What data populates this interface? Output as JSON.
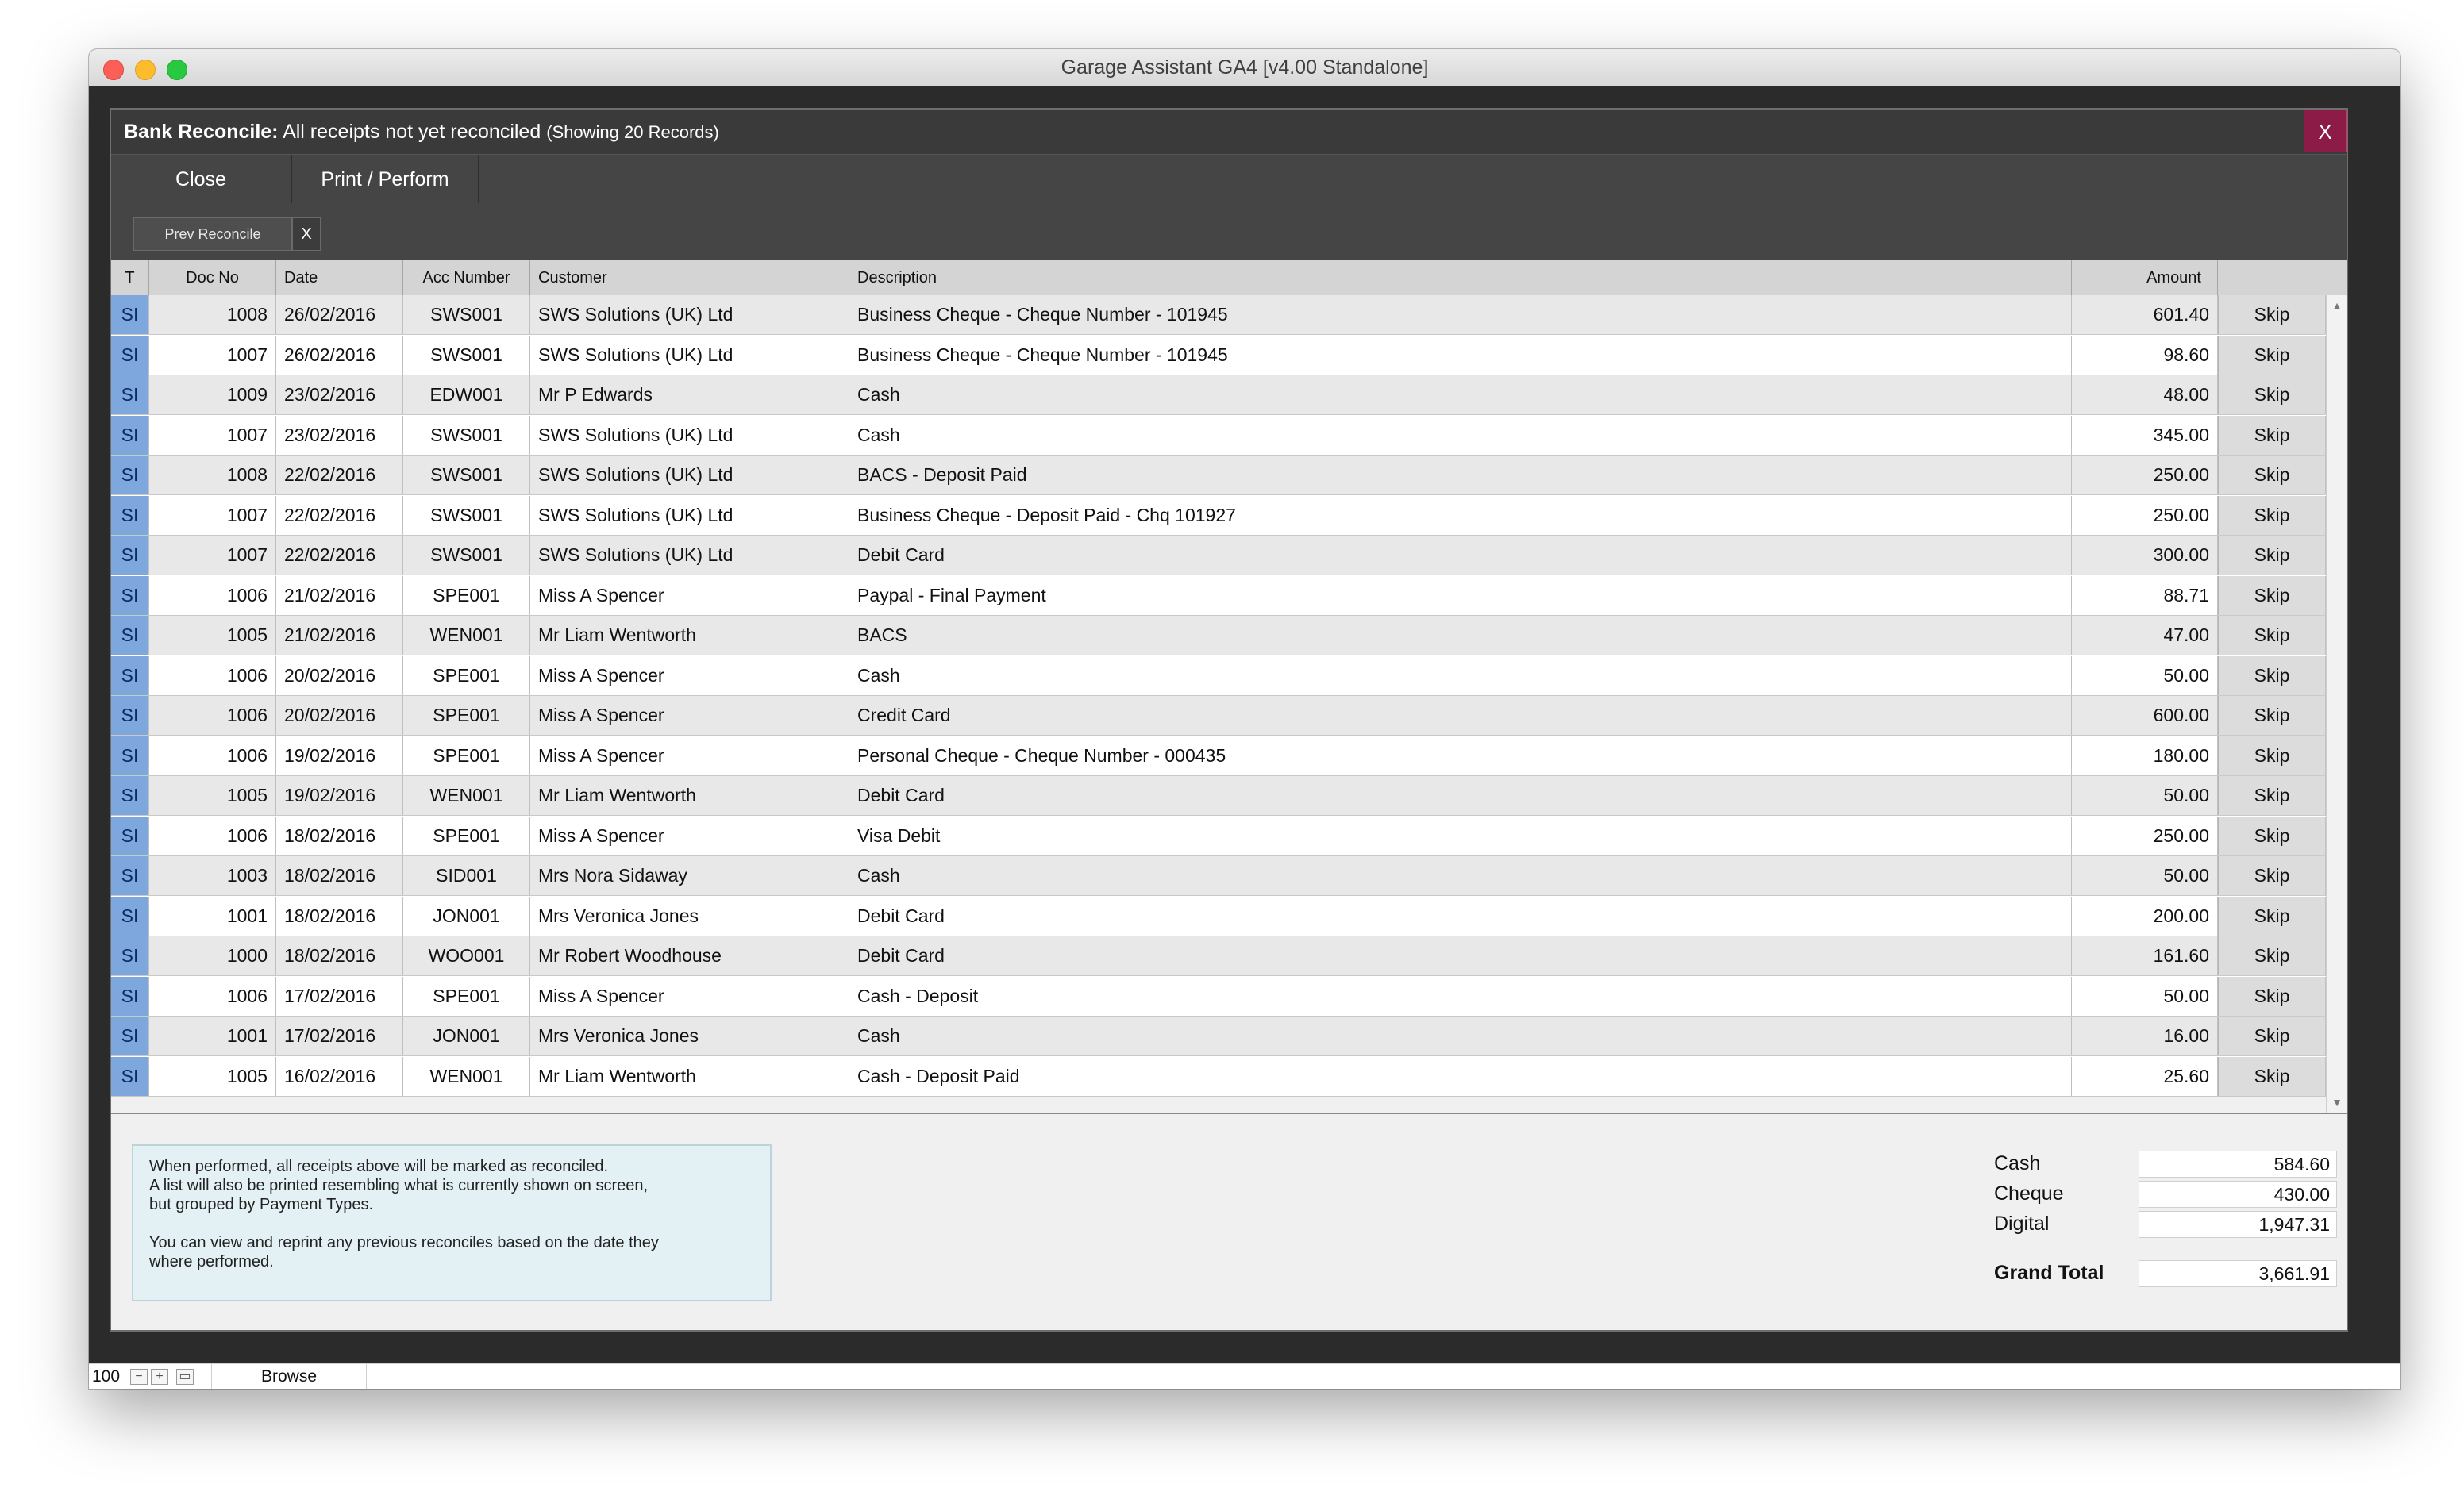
{
  "window": {
    "title": "Garage Assistant GA4 [v4.00 Standalone]"
  },
  "dialog": {
    "title_bold": "Bank Reconcile:",
    "title_rest": " All receipts not yet reconciled ",
    "title_count": "(Showing 20 Records)",
    "close_label": "X"
  },
  "toolbar": {
    "close_label": "Close",
    "print_label": "Print / Perform"
  },
  "filter": {
    "prev_label": "Prev Reconcile",
    "clear_label": "X"
  },
  "table": {
    "columns": {
      "t": "T",
      "doc": "Doc No",
      "date": "Date",
      "acc": "Acc Number",
      "customer": "Customer",
      "description": "Description",
      "amount": "Amount"
    },
    "rows": [
      {
        "t": "SI",
        "doc": "1008",
        "date": "26/02/2016",
        "acc": "SWS001",
        "customer": "SWS Solutions (UK) Ltd",
        "description": "Business Cheque - Cheque Number - 101945",
        "amount": "601.40",
        "action": "Skip"
      },
      {
        "t": "SI",
        "doc": "1007",
        "date": "26/02/2016",
        "acc": "SWS001",
        "customer": "SWS Solutions (UK) Ltd",
        "description": "Business Cheque - Cheque Number - 101945",
        "amount": "98.60",
        "action": "Skip"
      },
      {
        "t": "SI",
        "doc": "1009",
        "date": "23/02/2016",
        "acc": "EDW001",
        "customer": "Mr P Edwards",
        "description": "Cash",
        "amount": "48.00",
        "action": "Skip"
      },
      {
        "t": "SI",
        "doc": "1007",
        "date": "23/02/2016",
        "acc": "SWS001",
        "customer": "SWS Solutions (UK) Ltd",
        "description": "Cash",
        "amount": "345.00",
        "action": "Skip"
      },
      {
        "t": "SI",
        "doc": "1008",
        "date": "22/02/2016",
        "acc": "SWS001",
        "customer": "SWS Solutions (UK) Ltd",
        "description": "BACS - Deposit Paid",
        "amount": "250.00",
        "action": "Skip"
      },
      {
        "t": "SI",
        "doc": "1007",
        "date": "22/02/2016",
        "acc": "SWS001",
        "customer": "SWS Solutions (UK) Ltd",
        "description": "Business Cheque - Deposit Paid - Chq 101927",
        "amount": "250.00",
        "action": "Skip"
      },
      {
        "t": "SI",
        "doc": "1007",
        "date": "22/02/2016",
        "acc": "SWS001",
        "customer": "SWS Solutions (UK) Ltd",
        "description": "Debit Card",
        "amount": "300.00",
        "action": "Skip"
      },
      {
        "t": "SI",
        "doc": "1006",
        "date": "21/02/2016",
        "acc": "SPE001",
        "customer": "Miss A Spencer",
        "description": "Paypal - Final Payment",
        "amount": "88.71",
        "action": "Skip"
      },
      {
        "t": "SI",
        "doc": "1005",
        "date": "21/02/2016",
        "acc": "WEN001",
        "customer": "Mr Liam Wentworth",
        "description": "BACS",
        "amount": "47.00",
        "action": "Skip"
      },
      {
        "t": "SI",
        "doc": "1006",
        "date": "20/02/2016",
        "acc": "SPE001",
        "customer": "Miss A Spencer",
        "description": "Cash",
        "amount": "50.00",
        "action": "Skip"
      },
      {
        "t": "SI",
        "doc": "1006",
        "date": "20/02/2016",
        "acc": "SPE001",
        "customer": "Miss A Spencer",
        "description": "Credit Card",
        "amount": "600.00",
        "action": "Skip"
      },
      {
        "t": "SI",
        "doc": "1006",
        "date": "19/02/2016",
        "acc": "SPE001",
        "customer": "Miss A Spencer",
        "description": "Personal Cheque - Cheque Number - 000435",
        "amount": "180.00",
        "action": "Skip"
      },
      {
        "t": "SI",
        "doc": "1005",
        "date": "19/02/2016",
        "acc": "WEN001",
        "customer": "Mr Liam Wentworth",
        "description": "Debit Card",
        "amount": "50.00",
        "action": "Skip"
      },
      {
        "t": "SI",
        "doc": "1006",
        "date": "18/02/2016",
        "acc": "SPE001",
        "customer": "Miss A Spencer",
        "description": "Visa Debit",
        "amount": "250.00",
        "action": "Skip"
      },
      {
        "t": "SI",
        "doc": "1003",
        "date": "18/02/2016",
        "acc": "SID001",
        "customer": "Mrs Nora Sidaway",
        "description": "Cash",
        "amount": "50.00",
        "action": "Skip"
      },
      {
        "t": "SI",
        "doc": "1001",
        "date": "18/02/2016",
        "acc": "JON001",
        "customer": "Mrs Veronica Jones",
        "description": "Debit Card",
        "amount": "200.00",
        "action": "Skip"
      },
      {
        "t": "SI",
        "doc": "1000",
        "date": "18/02/2016",
        "acc": "WOO001",
        "customer": "Mr Robert Woodhouse",
        "description": "Debit Card",
        "amount": "161.60",
        "action": "Skip"
      },
      {
        "t": "SI",
        "doc": "1006",
        "date": "17/02/2016",
        "acc": "SPE001",
        "customer": "Miss A Spencer",
        "description": "Cash - Deposit",
        "amount": "50.00",
        "action": "Skip"
      },
      {
        "t": "SI",
        "doc": "1001",
        "date": "17/02/2016",
        "acc": "JON001",
        "customer": "Mrs Veronica Jones",
        "description": "Cash",
        "amount": "16.00",
        "action": "Skip"
      },
      {
        "t": "SI",
        "doc": "1005",
        "date": "16/02/2016",
        "acc": "WEN001",
        "customer": "Mr Liam Wentworth",
        "description": "Cash - Deposit Paid",
        "amount": "25.60",
        "action": "Skip"
      }
    ]
  },
  "info": {
    "line1": "When performed, all receipts above will be marked as reconciled.",
    "line2": "A list will also be printed resembling what is currently shown on screen,",
    "line3": "but grouped by Payment Types.",
    "line4": "You can view and reprint any previous reconciles based on the date they",
    "line5": "where performed."
  },
  "totals": {
    "cash_label": "Cash",
    "cash": "584.60",
    "cheque_label": "Cheque",
    "cheque": "430.00",
    "digital_label": "Digital",
    "digital": "1,947.31",
    "grand_label": "Grand Total",
    "grand": "3,661.91"
  },
  "statusbar": {
    "zoom": "100",
    "mode": "Browse"
  },
  "colors": {
    "type_cell": "#7ea7de",
    "close_button": "#8c1b47",
    "header_bar": "#3a3a3a"
  }
}
